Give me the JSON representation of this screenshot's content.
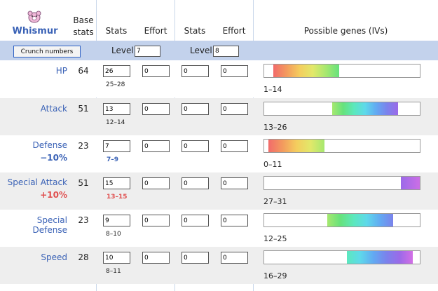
{
  "pokemon": {
    "name": "Whismur"
  },
  "headers": {
    "base_stats": "Base\nstats",
    "stats_1": "Stats",
    "effort_1": "Effort",
    "stats_2": "Stats",
    "effort_2": "Effort",
    "genes": "Possible genes (IVs)"
  },
  "controls": {
    "crunch_label": "Crunch numbers",
    "level_label_1": "Level",
    "level_1": "7",
    "level_label_2": "Level",
    "level_2": "8"
  },
  "rows": [
    {
      "name": "HP",
      "modifier": "",
      "modifier_type": "",
      "base": "64",
      "stat1": "26",
      "effort1": "0",
      "stat2": "0",
      "effort2": "0",
      "range": "25–28",
      "range_style": "",
      "iv_text": "1–14",
      "iv_min": 1,
      "iv_max": 14
    },
    {
      "name": "Attack",
      "modifier": "",
      "modifier_type": "",
      "base": "51",
      "stat1": "13",
      "effort1": "0",
      "stat2": "0",
      "effort2": "0",
      "range": "12–14",
      "range_style": "",
      "iv_text": "13–26",
      "iv_min": 13,
      "iv_max": 26
    },
    {
      "name": "Defense",
      "modifier": "−10%",
      "modifier_type": "minus",
      "base": "23",
      "stat1": "7",
      "effort1": "0",
      "stat2": "0",
      "effort2": "0",
      "range": "7–9",
      "range_style": "blue",
      "iv_text": "0–11",
      "iv_min": 0,
      "iv_max": 11
    },
    {
      "name": "Special Attack",
      "modifier": "+10%",
      "modifier_type": "plus",
      "base": "51",
      "stat1": "15",
      "effort1": "0",
      "stat2": "0",
      "effort2": "0",
      "range": "13–15",
      "range_style": "red",
      "iv_text": "27–31",
      "iv_min": 27,
      "iv_max": 31
    },
    {
      "name": "Special Defense",
      "modifier": "",
      "modifier_type": "",
      "base": "23",
      "stat1": "9",
      "effort1": "0",
      "stat2": "0",
      "effort2": "0",
      "range": "8–10",
      "range_style": "",
      "iv_text": "12–25",
      "iv_min": 12,
      "iv_max": 25
    },
    {
      "name": "Speed",
      "modifier": "",
      "modifier_type": "",
      "base": "28",
      "stat1": "10",
      "effort1": "0",
      "stat2": "0",
      "effort2": "0",
      "range": "8–11",
      "range_style": "",
      "iv_text": "16–29",
      "iv_min": 16,
      "iv_max": 29
    }
  ],
  "iv_scale_max": 31,
  "iv_gradient_colors": [
    "#f26b6b",
    "#f39a5e",
    "#f4cd5e",
    "#e2e86a",
    "#a6e86f",
    "#66e27c",
    "#5ce8bd",
    "#5ed9ea",
    "#62aaf2",
    "#7b82ec",
    "#9b6ae8",
    "#d36fe6"
  ]
}
